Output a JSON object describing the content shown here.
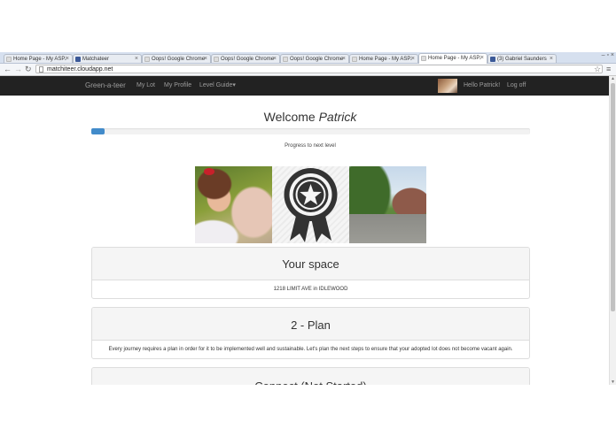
{
  "browser": {
    "tabs": [
      {
        "label": "Home Page - My ASP.N",
        "fav": "page",
        "active": false
      },
      {
        "label": "Matchateer",
        "fav": "fb",
        "active": false
      },
      {
        "label": "Oops! Google Chrome c",
        "fav": "page",
        "active": false
      },
      {
        "label": "Oops! Google Chrome c",
        "fav": "page",
        "active": false
      },
      {
        "label": "Oops! Google Chrome c",
        "fav": "page",
        "active": false
      },
      {
        "label": "Home Page - My ASP.N",
        "fav": "page",
        "active": false
      },
      {
        "label": "Home Page - My ASP.N",
        "fav": "page",
        "active": true
      },
      {
        "label": "(3) Gabriel Saunders",
        "fav": "fb",
        "active": false
      }
    ],
    "tab_close_glyph": "×",
    "window_controls": "– ▫ ×",
    "url": "matchiteer.cloudapp.net",
    "back_icon": "←",
    "forward_icon": "→",
    "reload_icon": "↻",
    "star_icon": "☆",
    "menu_icon": "≡"
  },
  "navbar": {
    "brand": "Green-a-teer",
    "items": [
      "My Lot",
      "My Profile",
      "Level Guide"
    ],
    "caret": "▾",
    "greeting": "Hello Patrick!",
    "logoff": "Log off"
  },
  "welcome": {
    "prefix": "Welcome ",
    "name": "Patrick"
  },
  "progress": {
    "value": 0.03,
    "label": "Progress to next level"
  },
  "panels": [
    {
      "title": "Your space",
      "body": "1218 LIMIT AVE in IDLEWOOD"
    },
    {
      "title": "2 - Plan",
      "body": "Every journey requires a plan in order for it to be implemented well and sustainable. Let's plan the next steps to ensure that your adopted lot does not become vacant again."
    },
    {
      "title": "Connect (Not Started)",
      "body": ""
    }
  ],
  "colors": {
    "navbar_bg": "#222222",
    "progress_fill": "#428bca",
    "panel_head_bg": "#f5f5f5"
  },
  "icons": {
    "badge": "award-ribbon-star-icon"
  }
}
